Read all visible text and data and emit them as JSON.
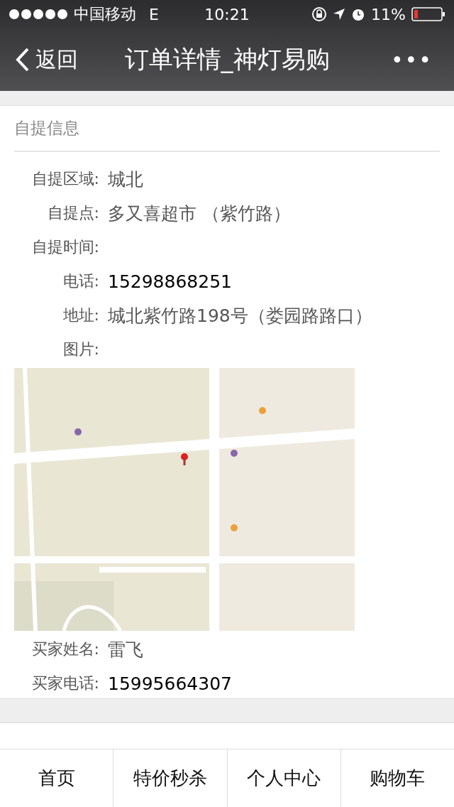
{
  "status_bar": {
    "carrier": "中国移动",
    "network": "E",
    "time": "10:21",
    "battery": "11%"
  },
  "nav": {
    "back": "返回",
    "title": "订单详情_神灯易购",
    "more": "•••"
  },
  "section": {
    "title": "自提信息",
    "fields": [
      {
        "label": "自提区域:",
        "value": "城北",
        "kind": "text"
      },
      {
        "label": "自提点:",
        "value": "多又喜超市 （紫竹路）",
        "kind": "text"
      },
      {
        "label": "自提时间:",
        "kind": "text"
      },
      {
        "label": "电话:",
        "value": "15298868251",
        "kind": "phone"
      },
      {
        "label": "地址:",
        "value": "城北紫竹路198号（娄园路路口）",
        "kind": "text"
      },
      {
        "label": "图片:",
        "kind": "text"
      },
      {
        "kind": "picture"
      },
      {
        "label": "买家姓名:",
        "value": "雷飞",
        "kind": "text"
      },
      {
        "label": "买家电话:",
        "value": "15995664307",
        "kind": "phone"
      }
    ]
  },
  "tabs": [
    {
      "label": "首页",
      "selected": false
    },
    {
      "label": "特价秒杀",
      "selected": false
    },
    {
      "label": "个人中心",
      "selected": false
    },
    {
      "label": "购物车",
      "selected": false
    }
  ]
}
